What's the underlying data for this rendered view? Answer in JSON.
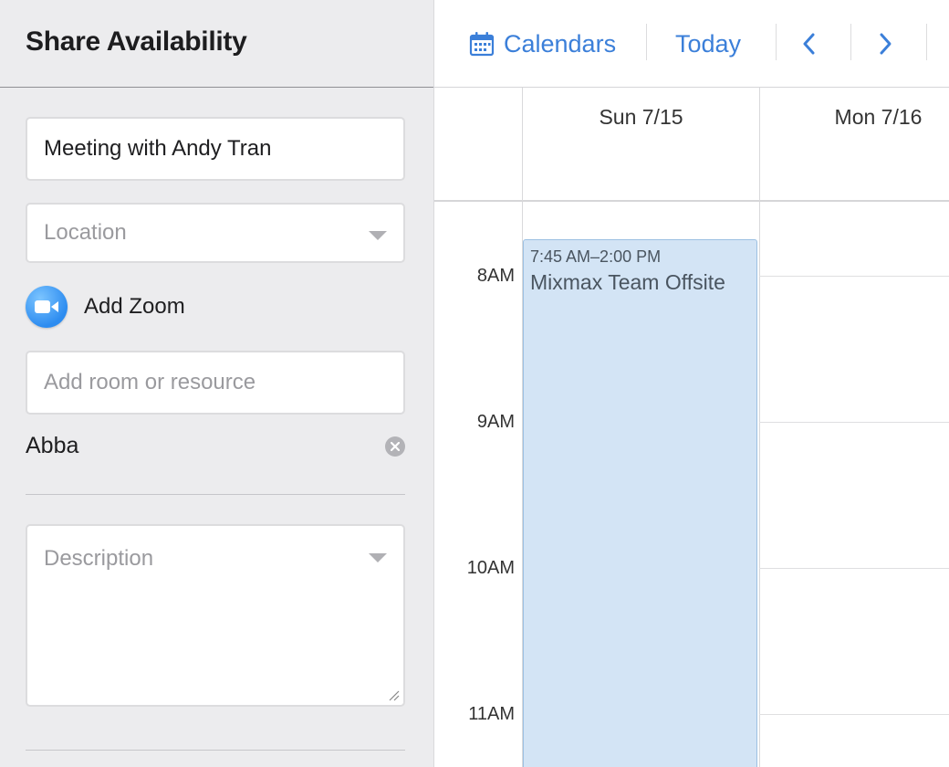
{
  "sidebar": {
    "title": "Share Availability",
    "meeting_title_value": "Meeting with Andy Tran",
    "location_placeholder": "Location",
    "zoom_label": "Add Zoom",
    "room_placeholder": "Add room or resource",
    "selected_resource": "Abba",
    "description_placeholder": "Description"
  },
  "toolbar": {
    "calendars_label": "Calendars",
    "today_label": "Today",
    "prev_icon": "chevron-left-icon",
    "next_icon": "chevron-right-icon"
  },
  "calendar": {
    "days": [
      "Sun 7/15",
      "Mon 7/16"
    ],
    "hours": [
      "8AM",
      "9AM",
      "10AM",
      "11AM"
    ],
    "events": [
      {
        "time": "7:45 AM–2:00 PM",
        "title": "Mixmax Team Offsite"
      }
    ]
  },
  "colors": {
    "accent": "#3b7fd9",
    "event_bg": "#d3e4f5",
    "sidebar_bg": "#ececee"
  }
}
